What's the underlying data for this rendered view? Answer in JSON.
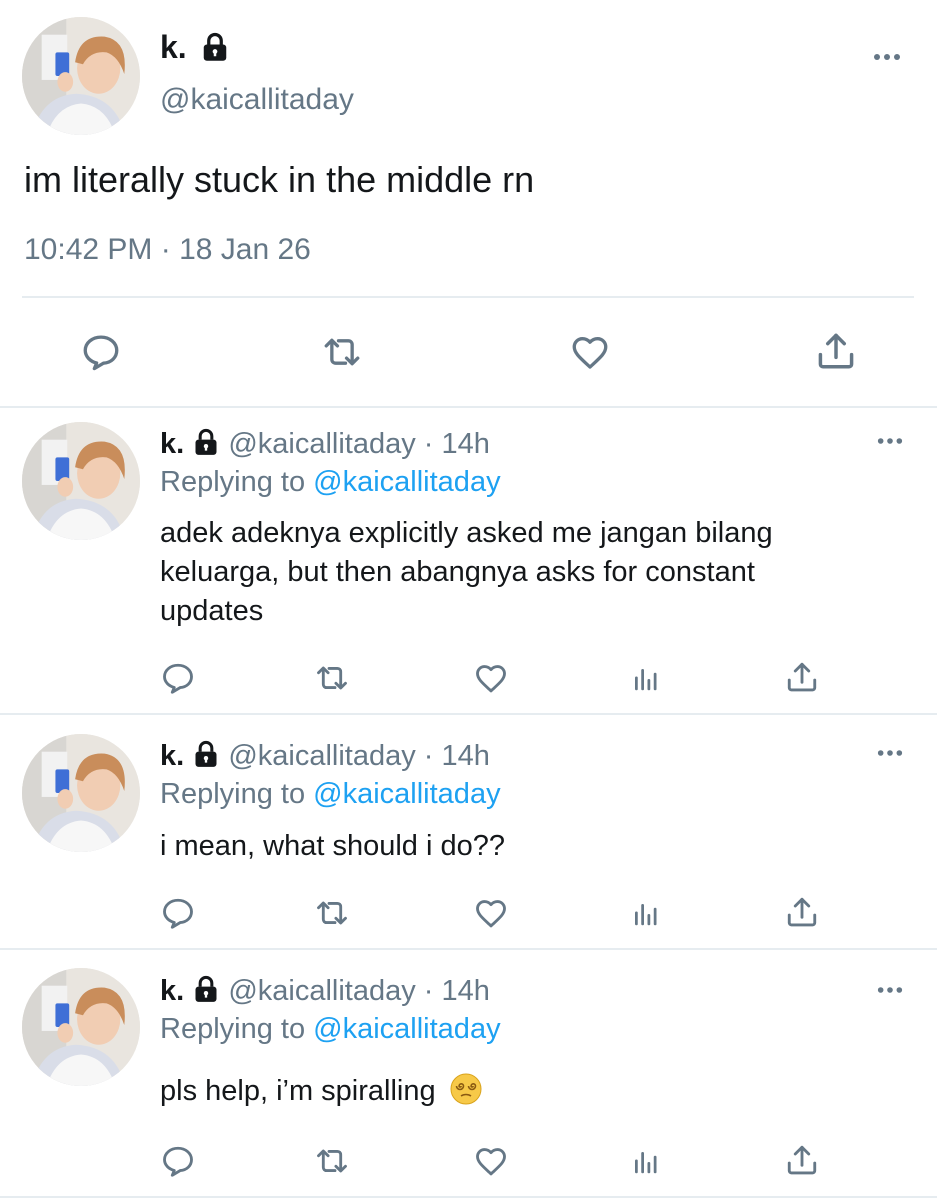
{
  "main_tweet": {
    "display_name": "k.",
    "handle": "@kaicallitaday",
    "text": "im literally stuck in the middle rn",
    "timestamp": "10:42 PM · 18 Jan 26",
    "actions": [
      "reply-icon",
      "retweet-icon",
      "like-icon",
      "share-icon"
    ]
  },
  "replies": [
    {
      "display_name": "k.",
      "handle": "@kaicallitaday",
      "time": "· 14h",
      "replying_label": "Replying to",
      "replying_handle": "@kaicallitaday",
      "text_lines": [
        "adek adeknya explicitly asked me jangan bilang",
        "keluarga, but then abangnya asks for constant",
        "updates"
      ]
    },
    {
      "display_name": "k.",
      "handle": "@kaicallitaday",
      "time": "· 14h",
      "replying_label": "Replying to",
      "replying_handle": "@kaicallitaday",
      "text_lines": [
        "i mean, what should i do??"
      ]
    },
    {
      "display_name": "k.",
      "handle": "@kaicallitaday",
      "time": "· 14h",
      "replying_label": "Replying to",
      "replying_handle": "@kaicallitaday",
      "text_lines": [
        "pls help, i’m spiralling"
      ],
      "emoji": "dizzy-face-emoji"
    }
  ],
  "reply_actions": [
    "reply-icon",
    "retweet-icon",
    "like-icon",
    "analytics-icon",
    "share-icon"
  ],
  "colors": {
    "text": "#14171a",
    "secondary": "#657786",
    "link": "#1da1f2",
    "divider": "#e6ecf0"
  }
}
